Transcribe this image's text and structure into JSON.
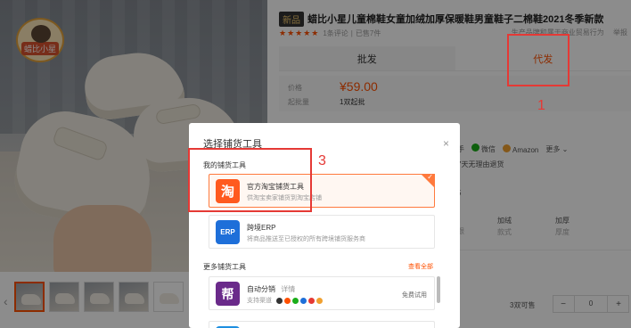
{
  "product": {
    "new_badge": "新品",
    "title": "蜡比小星儿童棉鞋女童加绒加厚保暖鞋男童鞋子二棉鞋2021冬季新款",
    "stars": "★★★★★",
    "reviews": "1条评论",
    "sold": "已售7件",
    "meta_right_1": "生产品牌和属于商业贸易行为",
    "meta_right_2": "举报",
    "brand_logo_text": "蜡比小星"
  },
  "tabs": {
    "wholesale": "批发",
    "dropship": "代发"
  },
  "price": {
    "price_label": "价格",
    "price_value": "¥59.00",
    "moq_label": "起批量",
    "moq_value": "1双起批"
  },
  "share": {
    "hand_partial": "手",
    "wechat": "微信",
    "amazon": "Amazon",
    "more": "更多 ⌄"
  },
  "side": {
    "return_text": "7天无理由退货",
    "five": "5",
    "spec1_v": "加绒",
    "spec1_k": "款式",
    "spec2_v": "加厚",
    "spec2_k": "厚度",
    "spec0_k": "跟",
    "stock": "3双可售",
    "qty": "0",
    "minus": "−",
    "plus": "+"
  },
  "modal": {
    "title": "选择铺货工具",
    "close": "×",
    "my_tools_title": "我的铺货工具",
    "more_tools_title": "更多铺货工具",
    "view_all": "查看全部",
    "tools": [
      {
        "icon_text": "淘",
        "name": "官方淘宝铺货工具",
        "desc": "供淘宝卖家铺货到淘宝店铺"
      },
      {
        "icon_text": "ERP",
        "name": "跨境ERP",
        "desc": "将商品推送至已授权的所有跨境铺货服务商"
      }
    ],
    "more_tools": [
      {
        "icon_text": "帮",
        "name": "自动分销",
        "detail": "详情",
        "support": "支持渠道",
        "trial": "免费试用"
      }
    ]
  },
  "annotations": {
    "n1": "1",
    "n3": "3"
  },
  "colors": {
    "accent": "#ff5000",
    "annotation": "#e53935",
    "taobao_icon": "#ff5a1f",
    "erp_icon": "#1e6fd9",
    "bang_icon": "#6a2a8a"
  }
}
